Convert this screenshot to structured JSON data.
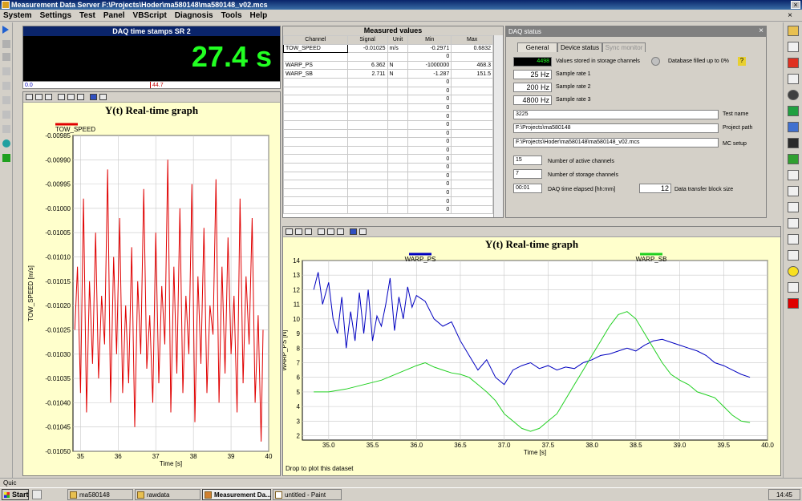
{
  "window": {
    "title": "Measurement Data Server F:\\Projects\\Hoder\\ma580148\\ma580148_v02.mcs"
  },
  "menu": [
    "System",
    "Settings",
    "Test",
    "Panel",
    "VBScript",
    "Diagnosis",
    "Tools",
    "Help"
  ],
  "daq": {
    "header": "DAQ time stamps SR 2",
    "value": "27.4 s",
    "bar_min": "0.0",
    "bar_marker": "44.7"
  },
  "measured": {
    "header": "Measured values",
    "columns": [
      "Channel",
      "Signal",
      "Unit",
      "Min",
      "Max"
    ],
    "rows": [
      [
        "TOW_SPEED",
        "-0.01025",
        "m/s",
        "-0.2971",
        "0.6832"
      ],
      [
        "",
        "",
        "",
        "0",
        ""
      ],
      [
        "WARP_PS",
        "6.362",
        "N",
        "-1000000",
        "468.3"
      ],
      [
        "WARP_SB",
        "2.711",
        "N",
        "-1.287",
        "151.5"
      ],
      [
        "",
        "",
        "",
        "0",
        ""
      ],
      [
        "",
        "",
        "",
        "0",
        ""
      ],
      [
        "",
        "",
        "",
        "0",
        ""
      ],
      [
        "",
        "",
        "",
        "0",
        ""
      ],
      [
        "",
        "",
        "",
        "0",
        ""
      ],
      [
        "",
        "",
        "",
        "0",
        ""
      ],
      [
        "",
        "",
        "",
        "0",
        ""
      ],
      [
        "",
        "",
        "",
        "0",
        ""
      ],
      [
        "",
        "",
        "",
        "0",
        ""
      ],
      [
        "",
        "",
        "",
        "0",
        ""
      ],
      [
        "",
        "",
        "",
        "0",
        ""
      ],
      [
        "",
        "",
        "",
        "0",
        ""
      ],
      [
        "",
        "",
        "",
        "0",
        ""
      ],
      [
        "",
        "",
        "",
        "0",
        ""
      ],
      [
        "",
        "",
        "",
        "0",
        ""
      ],
      [
        "",
        "",
        "",
        "0",
        ""
      ]
    ]
  },
  "status": {
    "title": "DAQ status",
    "tabs": [
      "General",
      "Device status",
      "Sync monitor"
    ],
    "stored_value": "4498",
    "stored_label": "Values stored in storage channels",
    "db_label": "Database filled up to 0%",
    "rates": [
      {
        "value": "25 Hz",
        "label": "Sample rate 1"
      },
      {
        "value": "200 Hz",
        "label": "Sample rate 2"
      },
      {
        "value": "4800 Hz",
        "label": "Sample rate 3"
      }
    ],
    "test_name_value": "3225",
    "test_name_label": "Test name",
    "project_path_value": "F:\\Projects\\ma580148",
    "project_path_label": "Project path",
    "mc_setup_value": "F:\\Projects\\Hoder\\ma580148\\ma580148_v02.mcs",
    "mc_setup_label": "MC setup",
    "active_channels_value": "15",
    "active_channels_label": "Number of active channels",
    "storage_channels_value": "7",
    "storage_channels_label": "Number of storage channels",
    "elapsed_value": "00:01",
    "elapsed_label": "DAQ time elapsed [hh:mm]",
    "block_value": "12",
    "block_label": "Data transfer block size"
  },
  "left_graph_title": "Y(t) Real-time graph",
  "right_graph_title": "Y(t) Real-time graph",
  "right_graph_hint": "Drop to plot this dataset",
  "bottom_status": "Quic",
  "taskbar": {
    "start": "Start",
    "tasks": [
      "ma580148",
      "rawdata",
      "Measurement Da...",
      "untitled - Paint"
    ],
    "clock": "14:45"
  },
  "chart_data": [
    {
      "type": "line",
      "title": "Y(t) Real-time graph",
      "xlabel": "Time [s]",
      "ylabel": "TOW_SPEED [m/s]",
      "xlim": [
        34.8,
        40.0
      ],
      "ylim": [
        -0.0105,
        -0.00985
      ],
      "xticks": [
        35,
        36,
        37,
        38,
        39,
        40
      ],
      "yticks": [
        -0.00985,
        -0.0099,
        -0.00995,
        -0.01,
        -0.01005,
        -0.0101,
        -0.01015,
        -0.0102,
        -0.01025,
        -0.0103,
        -0.01035,
        -0.0104,
        -0.01045,
        -0.0105
      ],
      "ytick_labels": [
        "-0.00985",
        "-0.00990",
        "-0.00995",
        "-0.01000",
        "-0.01005",
        "-0.01010",
        "-0.01015",
        "-0.01020",
        "-0.01025",
        "-0.01030",
        "-0.01035",
        "-0.01040",
        "-0.01045",
        "-0.01050"
      ],
      "grid": true,
      "series": [
        {
          "name": "TOW_SPEED",
          "color": "#e00000",
          "x": [
            34.85,
            34.92,
            35.0,
            35.08,
            35.16,
            35.24,
            35.32,
            35.4,
            35.48,
            35.56,
            35.64,
            35.72,
            35.8,
            35.88,
            35.96,
            36.04,
            36.12,
            36.2,
            36.28,
            36.36,
            36.44,
            36.52,
            36.6,
            36.68,
            36.76,
            36.84,
            36.92,
            37.0,
            37.08,
            37.16,
            37.24,
            37.32,
            37.4,
            37.48,
            37.56,
            37.64,
            37.72,
            37.8,
            37.88,
            37.96,
            38.04,
            38.12,
            38.2,
            38.28,
            38.36,
            38.44,
            38.52,
            38.6,
            38.68,
            38.76,
            38.84,
            38.92,
            39.0,
            39.08,
            39.16,
            39.24,
            39.32,
            39.4,
            39.48,
            39.56,
            39.64,
            39.72,
            39.8,
            39.85
          ],
          "y": [
            -0.01025,
            -0.01012,
            -0.01038,
            -0.00998,
            -0.01042,
            -0.01015,
            -0.01032,
            -0.01005,
            -0.01035,
            -0.01018,
            -0.01028,
            -0.00992,
            -0.0104,
            -0.0101,
            -0.0103,
            -0.01002,
            -0.01038,
            -0.0102,
            -0.01036,
            -0.01008,
            -0.01045,
            -0.01015,
            -0.0103,
            -0.00996,
            -0.01033,
            -0.01022,
            -0.0104,
            -0.01005,
            -0.01036,
            -0.01016,
            -0.01028,
            -0.0099,
            -0.01042,
            -0.01012,
            -0.01034,
            -0.01,
            -0.01038,
            -0.01018,
            -0.0103,
            -0.00995,
            -0.01044,
            -0.01014,
            -0.01032,
            -0.01004,
            -0.01038,
            -0.0102,
            -0.01026,
            -0.00994,
            -0.0104,
            -0.01012,
            -0.01034,
            -0.01006,
            -0.0103,
            -0.01018,
            -0.01042,
            -0.00998,
            -0.01036,
            -0.01014,
            -0.01028,
            -0.01002,
            -0.0104,
            -0.01022,
            -0.01048,
            -0.01025
          ]
        }
      ]
    },
    {
      "type": "line",
      "title": "Y(t) Real-time graph",
      "xlabel": "Time [s]",
      "ylabel": "WARP_PS [N]",
      "xlim": [
        34.7,
        40.0
      ],
      "ylim": [
        1.7,
        14.0
      ],
      "xticks": [
        35.0,
        35.5,
        36.0,
        36.5,
        37.0,
        37.5,
        38.0,
        38.5,
        39.0,
        39.5,
        40.0
      ],
      "xtick_labels": [
        "35.0",
        "35.5",
        "36.0",
        "36.5",
        "37.0",
        "37.5",
        "38.0",
        "38.5",
        "39.0",
        "39.5",
        "40.0"
      ],
      "yticks": [
        2,
        3,
        4,
        5,
        6,
        7,
        8,
        9,
        10,
        11,
        12,
        13,
        14
      ],
      "grid": true,
      "series": [
        {
          "name": "WARP_PS",
          "color": "#0000c0",
          "x": [
            34.83,
            34.88,
            34.93,
            35.0,
            35.05,
            35.1,
            35.15,
            35.2,
            35.25,
            35.3,
            35.35,
            35.4,
            35.45,
            35.5,
            35.55,
            35.6,
            35.65,
            35.7,
            35.75,
            35.8,
            35.85,
            35.9,
            35.95,
            36.0,
            36.1,
            36.2,
            36.3,
            36.4,
            36.5,
            36.6,
            36.7,
            36.8,
            36.9,
            37.0,
            37.1,
            37.2,
            37.3,
            37.4,
            37.5,
            37.6,
            37.7,
            37.8,
            37.9,
            38.0,
            38.1,
            38.2,
            38.3,
            38.4,
            38.5,
            38.6,
            38.7,
            38.8,
            38.9,
            39.0,
            39.1,
            39.2,
            39.3,
            39.4,
            39.5,
            39.6,
            39.7,
            39.8
          ],
          "y": [
            12.0,
            13.2,
            11.0,
            12.5,
            10.0,
            9.0,
            11.5,
            8.0,
            10.5,
            8.5,
            11.8,
            9.0,
            12.0,
            8.5,
            10.2,
            9.5,
            11.0,
            12.8,
            9.2,
            11.5,
            10.0,
            12.2,
            10.8,
            11.6,
            11.2,
            10.0,
            9.5,
            9.8,
            8.5,
            7.5,
            6.5,
            7.2,
            6.0,
            5.5,
            6.5,
            6.8,
            7.0,
            6.6,
            6.8,
            6.5,
            6.7,
            6.6,
            7.0,
            7.2,
            7.5,
            7.6,
            7.8,
            8.0,
            7.8,
            8.2,
            8.5,
            8.6,
            8.4,
            8.2,
            8.0,
            7.8,
            7.5,
            7.0,
            6.8,
            6.5,
            6.2,
            6.0
          ]
        },
        {
          "name": "WARP_SB",
          "color": "#20d020",
          "x": [
            34.83,
            35.0,
            35.2,
            35.4,
            35.6,
            35.8,
            36.0,
            36.1,
            36.2,
            36.3,
            36.4,
            36.5,
            36.6,
            36.7,
            36.8,
            36.9,
            37.0,
            37.1,
            37.2,
            37.3,
            37.4,
            37.5,
            37.6,
            37.7,
            37.8,
            37.9,
            38.0,
            38.1,
            38.2,
            38.3,
            38.4,
            38.5,
            38.6,
            38.7,
            38.8,
            38.9,
            39.0,
            39.1,
            39.2,
            39.3,
            39.4,
            39.5,
            39.6,
            39.7,
            39.8
          ],
          "y": [
            5.0,
            5.0,
            5.2,
            5.5,
            5.8,
            6.3,
            6.8,
            7.0,
            6.7,
            6.5,
            6.3,
            6.2,
            6.0,
            5.5,
            5.0,
            4.4,
            3.5,
            3.0,
            2.5,
            2.3,
            2.5,
            3.0,
            3.5,
            4.5,
            5.5,
            6.5,
            7.5,
            8.5,
            9.5,
            10.3,
            10.5,
            10.0,
            9.0,
            8.0,
            7.0,
            6.2,
            5.8,
            5.5,
            5.0,
            4.8,
            4.6,
            4.0,
            3.4,
            3.0,
            2.9
          ]
        }
      ]
    }
  ],
  "colors": {
    "graph_bg": "#ffffcc",
    "daq_value": "#22ff22",
    "title_blue": "#0a246a"
  }
}
